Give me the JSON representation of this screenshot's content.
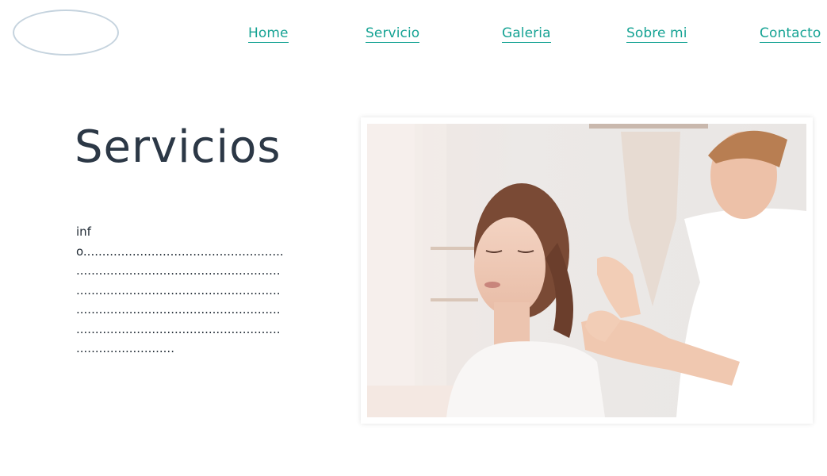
{
  "header": {
    "nav": [
      {
        "label": "Home"
      },
      {
        "label": "Servicio"
      },
      {
        "label": "Galeria"
      },
      {
        "label": "Sobre mi"
      },
      {
        "label": "Contacto"
      }
    ],
    "accent_color": "#16a394"
  },
  "main": {
    "title": "Servicios",
    "info_text": "info.......................................................................................................................................................................................................................................................................................................",
    "image": {
      "subject": "therapy-session-photo"
    }
  }
}
